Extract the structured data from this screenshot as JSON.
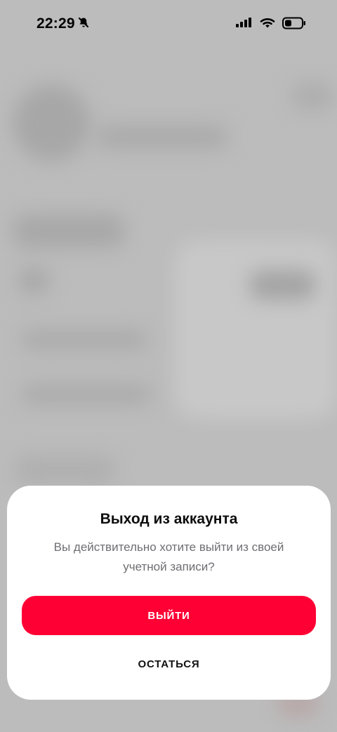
{
  "status_bar": {
    "time": "22:29",
    "icons": [
      "bell-slash-icon",
      "cellular-signal-icon",
      "wifi-icon",
      "battery-icon"
    ]
  },
  "dialog": {
    "title": "Выход из аккаунта",
    "message": "Вы действительно хотите выйти из своей учетной записи?",
    "primary_button_label": "ВЫЙТИ",
    "secondary_button_label": "ОСТАТЬСЯ"
  },
  "colors": {
    "accent": "#ff0035",
    "backdrop": "#bcbcbc",
    "sheet_background": "#ffffff",
    "title_text": "#0d0d0d",
    "message_text": "#6e6e73"
  }
}
